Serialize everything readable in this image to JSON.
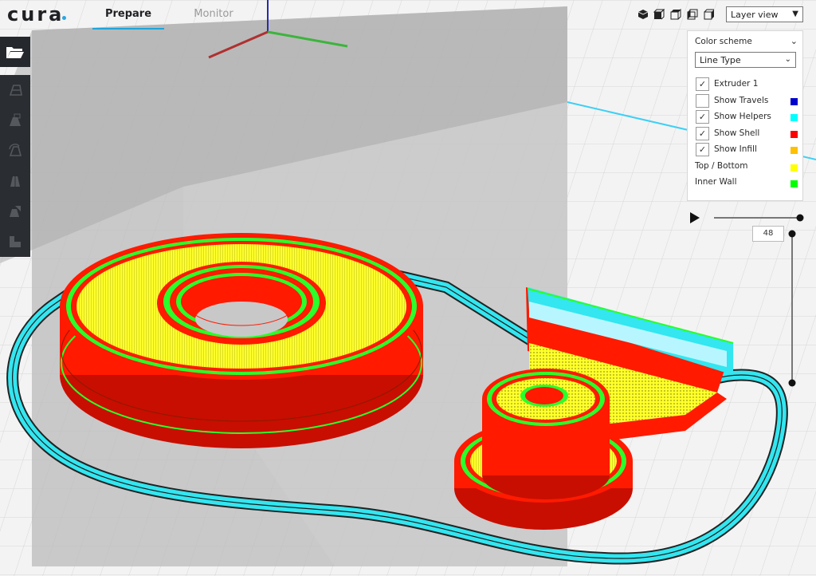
{
  "app": {
    "logo_text": "cura",
    "tabs": [
      {
        "label": "Prepare",
        "active": true
      },
      {
        "label": "Monitor",
        "active": false
      }
    ],
    "view_buttons": [
      "3d-view-icon",
      "front-view-icon",
      "top-view-icon",
      "left-view-icon",
      "right-view-icon"
    ],
    "view_mode": {
      "selected": "Layer view"
    }
  },
  "toolbar": {
    "items": [
      "open-file-icon",
      "move-tool-icon",
      "scale-tool-icon",
      "rotate-tool-icon",
      "mirror-tool-icon",
      "per-model-settings-icon",
      "support-blocker-icon"
    ]
  },
  "layer_panel": {
    "color_scheme_label": "Color scheme",
    "color_scheme_value": "Line Type",
    "options": [
      {
        "label": "Extruder 1",
        "checked": true,
        "color": ""
      },
      {
        "label": "Show Travels",
        "checked": false,
        "color": "#0000cc"
      },
      {
        "label": "Show Helpers",
        "checked": true,
        "color": "#00ffff"
      },
      {
        "label": "Show Shell",
        "checked": true,
        "color": "#ff0000"
      },
      {
        "label": "Show Infill",
        "checked": true,
        "color": "#ffc000"
      }
    ],
    "legend": [
      {
        "label": "Top / Bottom",
        "color": "#ffff00"
      },
      {
        "label": "Inner Wall",
        "color": "#00ff00"
      }
    ]
  },
  "layer_slider": {
    "current_layer": "48",
    "play_icon": "play-icon"
  },
  "colors": {
    "accent": "#1ea5db",
    "shell": "#ff1a00",
    "infill": "#ffff2a",
    "inner_wall": "#2aff2a",
    "helpers": "#33e6f0",
    "toolbar_bg": "#2a2d31"
  }
}
